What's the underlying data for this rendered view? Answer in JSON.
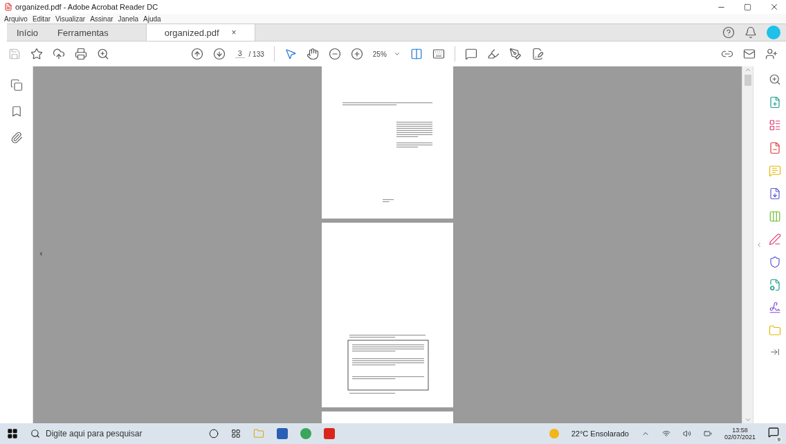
{
  "window": {
    "title": "organized.pdf - Adobe Acrobat Reader DC"
  },
  "menu": [
    "Arquivo",
    "Editar",
    "Visualizar",
    "Assinar",
    "Janela",
    "Ajuda"
  ],
  "tabs": [
    {
      "label": "Início",
      "selected": false
    },
    {
      "label": "Ferramentas",
      "selected": false
    },
    {
      "label": "organized.pdf",
      "selected": true,
      "close": "×"
    }
  ],
  "toolbar": {
    "page": "3",
    "page_total": "/ 133",
    "zoom": "25%"
  },
  "taskbar": {
    "search_placeholder": "Digite aqui para pesquisar",
    "weather": "22°C  Ensolarado",
    "time": "13:58",
    "date": "02/07/2021",
    "notifications": "9"
  }
}
